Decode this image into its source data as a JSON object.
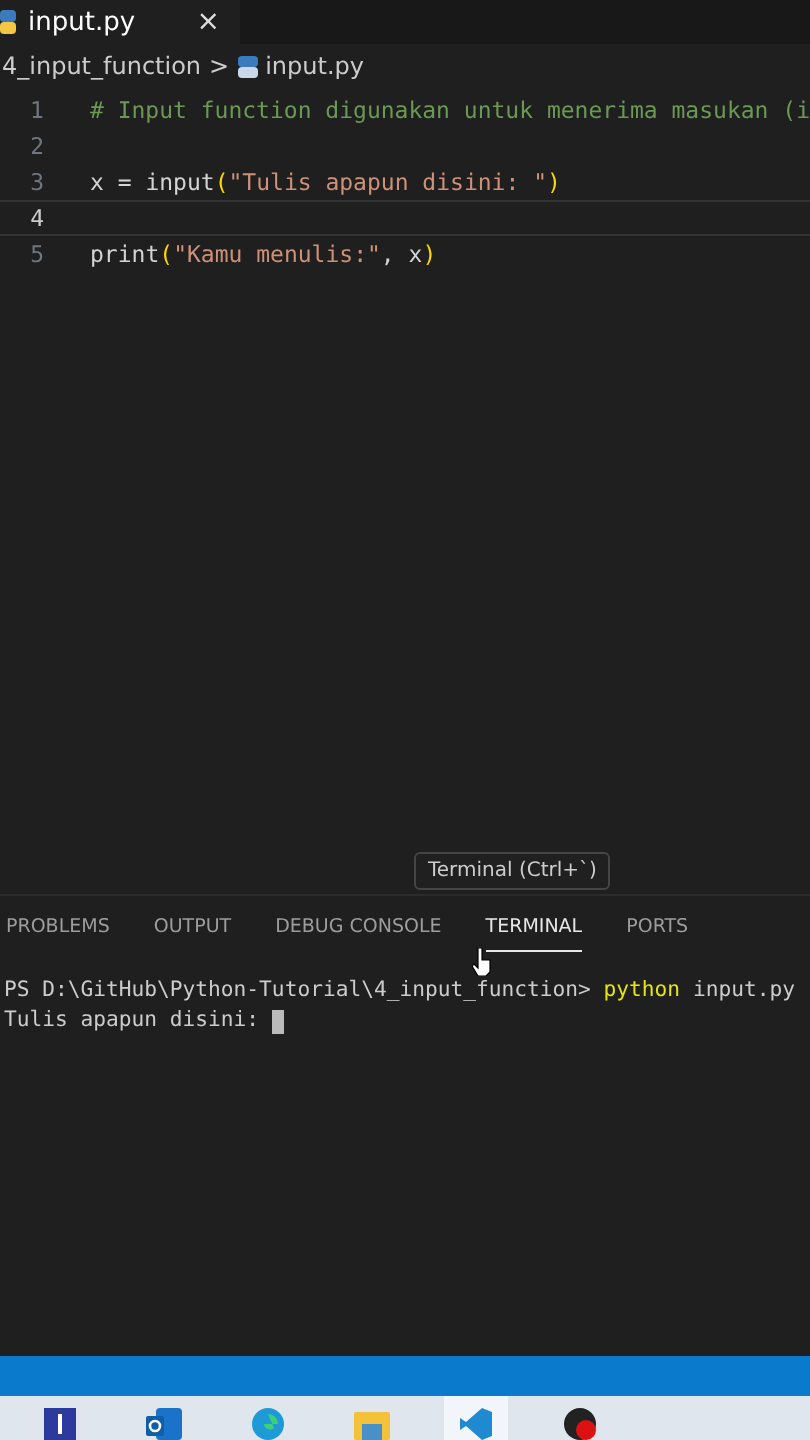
{
  "editor_tabs": [
    {
      "label": "input.py",
      "close": "×",
      "selected": true
    }
  ],
  "breadcrumb": {
    "folder": "4_input_function",
    "separator": ">",
    "file": "input.py"
  },
  "code_lines": [
    {
      "number": "1",
      "current": false,
      "tokens": [
        {
          "kind": "comment",
          "text": "# Input function digunakan untuk menerima masukan (i"
        }
      ]
    },
    {
      "number": "2",
      "current": false
    },
    {
      "number": "3",
      "current": false,
      "tokens": [
        {
          "kind": "plain",
          "text": "x = input"
        },
        {
          "kind": "paren",
          "text": "("
        },
        {
          "kind": "string",
          "text": "\"Tulis apapun disini: \""
        },
        {
          "kind": "paren",
          "text": ")"
        }
      ]
    },
    {
      "number": "4",
      "current": true
    },
    {
      "number": "5",
      "current": false,
      "tokens": [
        {
          "kind": "plain",
          "text": "print"
        },
        {
          "kind": "paren",
          "text": "("
        },
        {
          "kind": "string",
          "text": "\"Kamu menulis:\""
        },
        {
          "kind": "plain",
          "text": ", x"
        },
        {
          "kind": "paren",
          "text": ")"
        }
      ]
    }
  ],
  "tooltip": "Terminal (Ctrl+`)",
  "panel_tabs": [
    {
      "label": "PROBLEMS",
      "selected": false
    },
    {
      "label": "OUTPUT",
      "selected": false
    },
    {
      "label": "DEBUG CONSOLE",
      "selected": false
    },
    {
      "label": "TERMINAL",
      "selected": true
    },
    {
      "label": "PORTS",
      "selected": false
    }
  ],
  "terminal": {
    "prompt": "PS D:\\GitHub\\Python-Tutorial\\4_input_function>",
    "command": "python",
    "args": "input.py",
    "output": "Tulis apapun disini:"
  },
  "taskbar": [
    {
      "kind": "app-l",
      "selected": false
    },
    {
      "kind": "outlook",
      "selected": false
    },
    {
      "kind": "edge",
      "selected": false
    },
    {
      "kind": "folder",
      "selected": false
    },
    {
      "kind": "vscode",
      "selected": true
    },
    {
      "kind": "ball",
      "selected": false
    }
  ]
}
